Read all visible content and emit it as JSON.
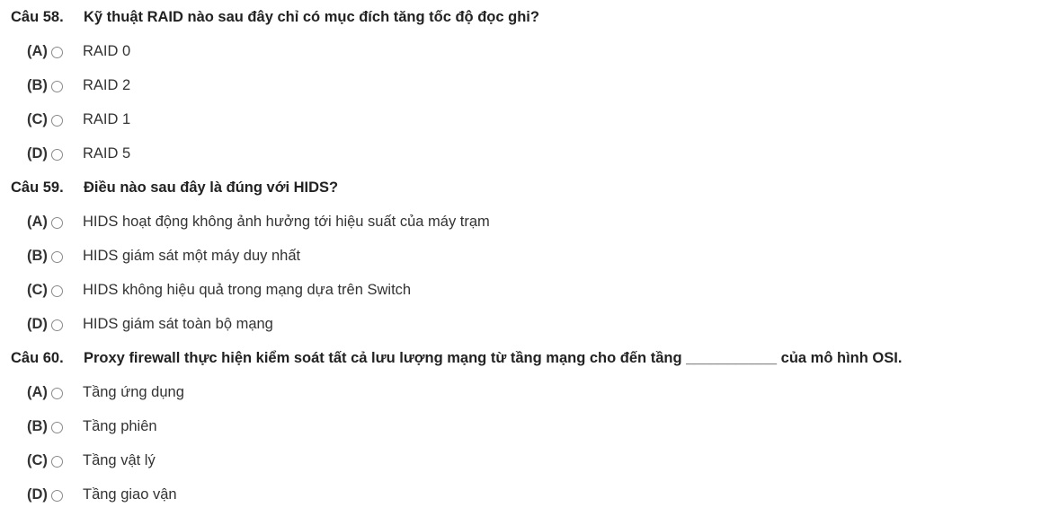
{
  "questions": [
    {
      "number": "Câu 58.",
      "text": "Kỹ thuật RAID nào sau đây chỉ có mục đích tăng tốc độ đọc ghi?",
      "options": [
        {
          "letter": "(A)",
          "text": "RAID 0"
        },
        {
          "letter": "(B)",
          "text": "RAID 2"
        },
        {
          "letter": "(C)",
          "text": "RAID 1"
        },
        {
          "letter": "(D)",
          "text": "RAID 5"
        }
      ]
    },
    {
      "number": "Câu 59.",
      "text": "Điều nào sau đây là đúng với HIDS?",
      "options": [
        {
          "letter": "(A)",
          "text": "HIDS hoạt động không ảnh hưởng tới hiệu suất của máy trạm"
        },
        {
          "letter": "(B)",
          "text": "HIDS giám sát một máy duy nhất"
        },
        {
          "letter": "(C)",
          "text": "HIDS không hiệu quả trong mạng dựa trên Switch"
        },
        {
          "letter": "(D)",
          "text": "HIDS giám sát toàn bộ mạng"
        }
      ]
    },
    {
      "number": "Câu 60.",
      "text": "Proxy firewall thực hiện kiểm soát tất cả lưu lượng mạng từ tầng mạng cho đến tầng ___________ của mô hình OSI.",
      "options": [
        {
          "letter": "(A)",
          "text": "Tầng ứng dụng"
        },
        {
          "letter": "(B)",
          "text": "Tầng phiên"
        },
        {
          "letter": "(C)",
          "text": "Tầng vật lý"
        },
        {
          "letter": "(D)",
          "text": "Tầng giao vận"
        }
      ]
    }
  ]
}
